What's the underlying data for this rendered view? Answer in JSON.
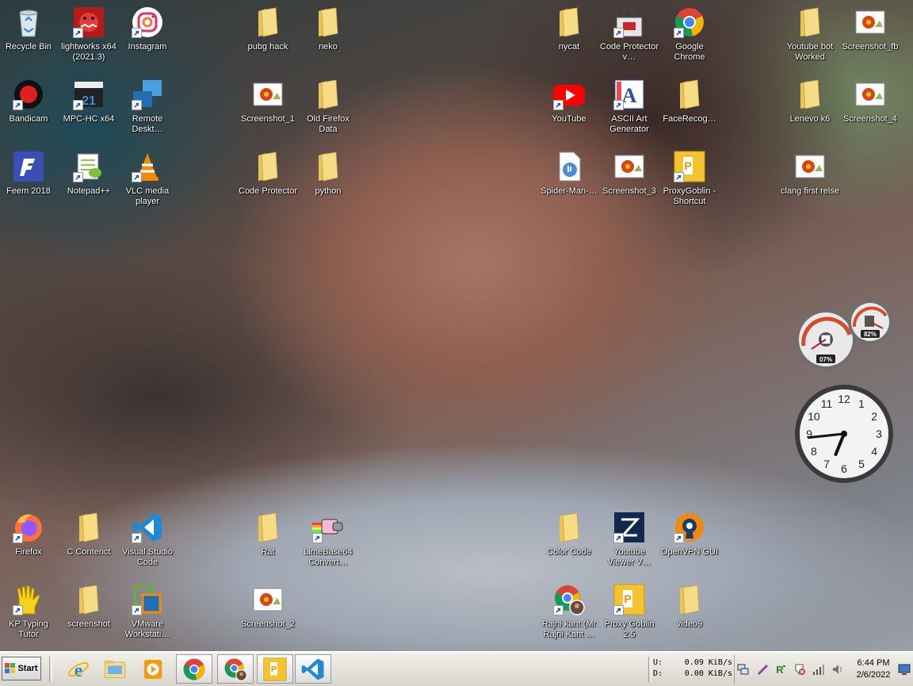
{
  "desktop": {
    "icons": [
      {
        "label": "Recycle Bin",
        "icon": "recycle-bin-icon",
        "shortcut": false
      },
      {
        "label": "lightworks x64 (2021.3)",
        "icon": "lightworks-icon",
        "shortcut": true
      },
      {
        "label": "Instagram",
        "icon": "instagram-icon",
        "shortcut": true
      },
      {
        "label": "pubg hack",
        "icon": "folder-icon",
        "shortcut": false
      },
      {
        "label": "neko",
        "icon": "folder-icon",
        "shortcut": false
      },
      {
        "label": "nycat",
        "icon": "folder-icon",
        "shortcut": false
      },
      {
        "label": "Code Protector v…",
        "icon": "code-protector-icon",
        "shortcut": true
      },
      {
        "label": "Google Chrome",
        "icon": "chrome-icon",
        "shortcut": true
      },
      {
        "label": "Youtube bot Worked",
        "icon": "folder-icon",
        "shortcut": false
      },
      {
        "label": "Screenshot_fb",
        "icon": "image-file-icon",
        "shortcut": false
      },
      {
        "label": "Bandicam",
        "icon": "bandicam-icon",
        "shortcut": true
      },
      {
        "label": "MPC-HC x64",
        "icon": "mpc-hc-icon",
        "shortcut": true
      },
      {
        "label": "Remote Deskt…",
        "icon": "remote-desktop-icon",
        "shortcut": true
      },
      {
        "label": "Screenshot_1",
        "icon": "image-file-icon",
        "shortcut": false
      },
      {
        "label": "Old Firefox Data",
        "icon": "folder-icon",
        "shortcut": false
      },
      {
        "label": "YouTube",
        "icon": "youtube-icon",
        "shortcut": true
      },
      {
        "label": "ASCII Art Generator",
        "icon": "ascii-art-icon",
        "shortcut": true
      },
      {
        "label": "FaceRecog…",
        "icon": "folder-icon",
        "shortcut": false
      },
      {
        "label": "Lenevo k6",
        "icon": "folder-icon",
        "shortcut": false
      },
      {
        "label": "Screenshot_4",
        "icon": "image-file-icon",
        "shortcut": false
      },
      {
        "label": "Feem 2018",
        "icon": "feem-icon",
        "shortcut": false
      },
      {
        "label": "Notepad++",
        "icon": "notepad-plus-plus-icon",
        "shortcut": true
      },
      {
        "label": "VLC media player",
        "icon": "vlc-icon",
        "shortcut": true
      },
      {
        "label": "Code Protector",
        "icon": "folder-icon",
        "shortcut": false
      },
      {
        "label": "python",
        "icon": "folder-icon",
        "shortcut": false
      },
      {
        "label": "Spider-Man-…",
        "icon": "audio-file-icon",
        "shortcut": false
      },
      {
        "label": "Screenshot_3",
        "icon": "image-file-icon",
        "shortcut": false
      },
      {
        "label": "ProxyGoblin - Shortcut",
        "icon": "proxy-goblin-icon",
        "shortcut": true
      },
      {
        "label": "clang first relse",
        "icon": "image-file-icon",
        "shortcut": false
      },
      {
        "label": "Firefox",
        "icon": "firefox-icon",
        "shortcut": true
      },
      {
        "label": "C Contenct",
        "icon": "folder-icon",
        "shortcut": false
      },
      {
        "label": "Visual Studio Code",
        "icon": "vscode-icon",
        "shortcut": true
      },
      {
        "label": "Rat",
        "icon": "folder-icon",
        "shortcut": false
      },
      {
        "label": "LimeBase64 Convert…",
        "icon": "nyan-cat-icon",
        "shortcut": true
      },
      {
        "label": "Color Code",
        "icon": "folder-icon",
        "shortcut": false
      },
      {
        "label": "Youtube Viewer V…",
        "icon": "youtube-viewer-icon",
        "shortcut": true
      },
      {
        "label": "OpenVPN GUI",
        "icon": "openvpn-icon",
        "shortcut": true
      },
      {
        "label": "KP Typing Tutor",
        "icon": "kp-typing-tutor-icon",
        "shortcut": true
      },
      {
        "label": "screenshot",
        "icon": "folder-icon",
        "shortcut": false
      },
      {
        "label": "VMware Workstati…",
        "icon": "vmware-icon",
        "shortcut": true
      },
      {
        "label": "Screenshot_2",
        "icon": "image-file-icon",
        "shortcut": false
      },
      {
        "label": "Rajni kant (Mr Rajni Kant …",
        "icon": "chrome-profile-icon",
        "shortcut": true
      },
      {
        "label": "Proxy Goblin 2.5",
        "icon": "proxy-goblin-icon",
        "shortcut": true
      },
      {
        "label": "video9",
        "icon": "folder-icon",
        "shortcut": false
      }
    ]
  },
  "gadgets": {
    "cpu_meter": {
      "cpu_percent_label": "07%",
      "memory_percent_label": "82%",
      "cpu_value": 0.07,
      "memory_value": 0.82
    },
    "clock": {
      "hour": 6,
      "minute": 44
    }
  },
  "taskbar": {
    "start_label": "Start",
    "apps": [
      {
        "name": "internet-explorer",
        "icon": "internet-explorer-icon"
      },
      {
        "name": "file-explorer",
        "icon": "file-explorer-icon"
      },
      {
        "name": "media-player",
        "icon": "media-player-icon"
      },
      {
        "name": "chrome-window-1",
        "icon": "chrome-icon"
      },
      {
        "name": "chrome-window-2",
        "icon": "chrome-profile-icon"
      },
      {
        "name": "proxy-goblin",
        "icon": "proxy-goblin-icon"
      },
      {
        "name": "vscode",
        "icon": "vscode-icon"
      }
    ],
    "netspeed": {
      "up_label": "U:",
      "up_value": "0.09 KiB/s",
      "down_label": "D:",
      "down_value": "0.00 KiB/s"
    },
    "tray_icons": [
      "network-icon",
      "pen-icon",
      "r-app-icon",
      "security-icon",
      "signal-icon",
      "volume-icon",
      "monitor-icon"
    ],
    "time": "6:44 PM",
    "date": "2/6/2022"
  },
  "colors": {
    "folder": "#f4d77c",
    "youtube_red": "#ff0000",
    "vscode_blue": "#1f8ad2",
    "chrome_red": "#db4437",
    "chrome_yellow": "#f4b400",
    "chrome_green": "#0f9d58",
    "chrome_blue": "#4285f4"
  }
}
